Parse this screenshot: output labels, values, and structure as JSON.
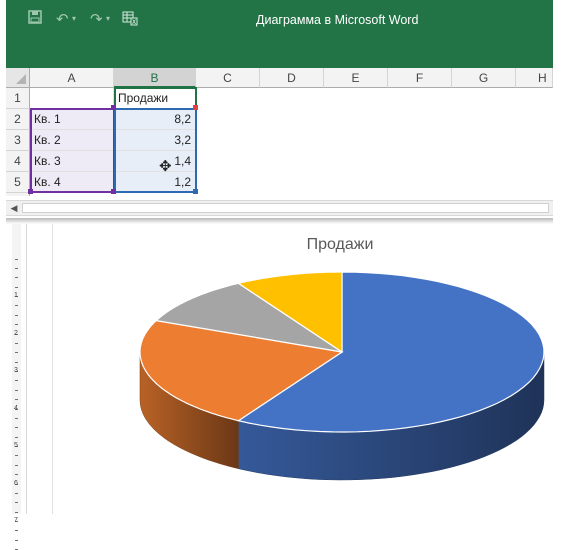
{
  "window": {
    "title": "Диаграмма в Microsoft Word",
    "qat": {
      "save_icon": "floppy-disk-icon",
      "undo_icon": "undo-icon",
      "redo_icon": "redo-icon",
      "edit_data_icon": "edit-data-in-excel-icon"
    },
    "colors": {
      "titlebar": "#227447",
      "selection_green": "#217346"
    }
  },
  "sheet": {
    "columns": [
      "A",
      "B",
      "C",
      "D",
      "E",
      "F",
      "G",
      "H"
    ],
    "rows": [
      "1",
      "2",
      "3",
      "4",
      "5"
    ],
    "header_cell": "Продажи",
    "data": [
      {
        "label": "Кв. 1",
        "value": "8,2"
      },
      {
        "label": "Кв. 2",
        "value": "3,2"
      },
      {
        "label": "Кв. 3",
        "value": "1,4"
      },
      {
        "label": "Кв. 4",
        "value": "1,2"
      }
    ],
    "range_colors": {
      "categories": "#7030a0",
      "values": "#2e6ab1",
      "series_name": "#217346"
    }
  },
  "ruler": {
    "labels": [
      "1",
      "2",
      "3",
      "4",
      "5",
      "6",
      "7"
    ]
  },
  "chart_data": {
    "type": "pie",
    "title": "Продажи",
    "categories": [
      "Кв. 1",
      "Кв. 2",
      "Кв. 3",
      "Кв. 4"
    ],
    "values": [
      8.2,
      3.2,
      1.4,
      1.2
    ],
    "colors": [
      "#4472c4",
      "#ed7d31",
      "#a5a5a5",
      "#ffc000"
    ],
    "style": "3d-pie"
  }
}
